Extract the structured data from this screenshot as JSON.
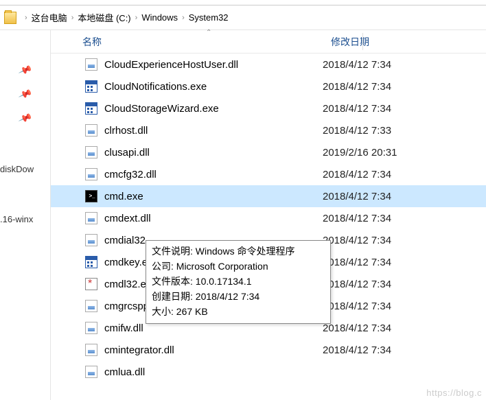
{
  "breadcrumb": {
    "items": [
      "这台电脑",
      "本地磁盘 (C:)",
      "Windows",
      "System32"
    ]
  },
  "sidebar": {
    "quick_access_items": [
      "diskDow",
      ".16-winx"
    ]
  },
  "columns": {
    "name": "名称",
    "date": "修改日期"
  },
  "files": [
    {
      "icon": "dll",
      "name": "CloudExperienceHostUser.dll",
      "date": "2018/4/12 7:34"
    },
    {
      "icon": "exe-blue",
      "name": "CloudNotifications.exe",
      "date": "2018/4/12 7:34"
    },
    {
      "icon": "exe-blue",
      "name": "CloudStorageWizard.exe",
      "date": "2018/4/12 7:34"
    },
    {
      "icon": "dll",
      "name": "clrhost.dll",
      "date": "2018/4/12 7:33"
    },
    {
      "icon": "dll",
      "name": "clusapi.dll",
      "date": "2019/2/16 20:31"
    },
    {
      "icon": "dll",
      "name": "cmcfg32.dll",
      "date": "2018/4/12 7:34"
    },
    {
      "icon": "cmd",
      "name": "cmd.exe",
      "date": "2018/4/12 7:34",
      "selected": true
    },
    {
      "icon": "dll",
      "name": "cmdext.dll",
      "date": "2018/4/12 7:34"
    },
    {
      "icon": "dll",
      "name": "cmdial32",
      "date": "2018/4/12 7:34"
    },
    {
      "icon": "exe-blue",
      "name": "cmdkey.e",
      "date": "2018/4/12 7:34"
    },
    {
      "icon": "sys",
      "name": "cmdl32.e",
      "date": "2018/4/12 7:34"
    },
    {
      "icon": "dll",
      "name": "cmgrcspp…",
      "date": "2018/4/12 7:34"
    },
    {
      "icon": "dll",
      "name": "cmifw.dll",
      "date": "2018/4/12 7:34"
    },
    {
      "icon": "dll",
      "name": "cmintegrator.dll",
      "date": "2018/4/12 7:34"
    },
    {
      "icon": "dll",
      "name": "cmlua.dll",
      "date": ""
    }
  ],
  "tooltip": {
    "l1": "文件说明: Windows 命令处理程序",
    "l2": "公司: Microsoft Corporation",
    "l3": "文件版本: 10.0.17134.1",
    "l4": "创建日期: 2018/4/12 7:34",
    "l5": "大小: 267 KB"
  },
  "watermark": "https://blog.c"
}
